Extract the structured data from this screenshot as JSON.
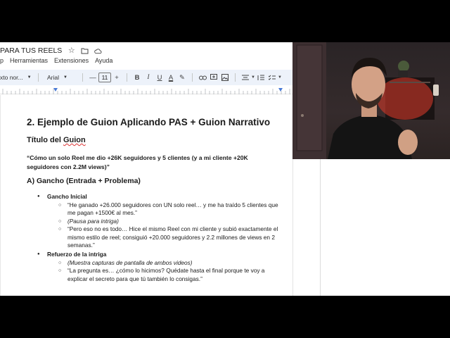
{
  "docs": {
    "title": "PARA TUS REELS",
    "menu": [
      "p",
      "Herramientas",
      "Extensiones",
      "Ayuda"
    ],
    "toolbar": {
      "style_select": "xto nor...",
      "font_select": "Arial",
      "font_size": "11",
      "minus": "—",
      "plus": "+"
    }
  },
  "content": {
    "heading": "2. Ejemplo de Guion Aplicando PAS + Guion Narrativo",
    "title_label_prefix": "Título del ",
    "title_label_word": "Guion",
    "quote": "“Cómo un solo Reel me dio +26K seguidores y 5 clientes (y a mi cliente +20K seguidores con 2.2M views)”",
    "section_a": "A) Gancho (Entrada + Problema)",
    "gancho_inicial": {
      "label": "Gancho Inicial",
      "items": [
        "“He ganado +26.000 seguidores con UN solo reel… y me ha traído 5 clientes que me pagan +1500€ al mes.”",
        "(Pausa para intriga)",
        "“Pero eso no es todo… Hice el mismo Reel con mi cliente y subió exactamente el mismo estilo de reel; consiguió +20.000 seguidores y 2.2 millones de views en 2 semanas.”"
      ]
    },
    "refuerzo": {
      "label": "Refuerzo de la intriga",
      "items": [
        "(Muestra capturas de pantalla de ambos videos)",
        "“La pregunta es… ¿cómo lo hicimos? Quédate hasta el final porque te voy a explicar el secreto para que tú también lo consigas.”"
      ]
    }
  },
  "colors": {
    "toolbar_bg": "#edf2fa",
    "spell_underline": "#d33",
    "backlight": "#e23a2a"
  }
}
